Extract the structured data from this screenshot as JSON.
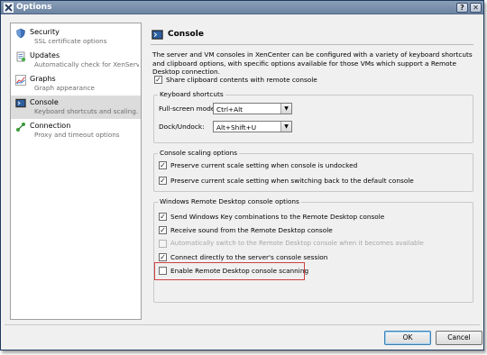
{
  "window": {
    "title": "Options"
  },
  "sidebar": {
    "items": [
      {
        "title": "Security",
        "desc": "SSL certificate options",
        "icon": "shield-icon",
        "selected": false
      },
      {
        "title": "Updates",
        "desc": "Automatically check for XenServ...",
        "icon": "updates-icon",
        "selected": false
      },
      {
        "title": "Graphs",
        "desc": "Graph appearance",
        "icon": "graph-icon",
        "selected": false
      },
      {
        "title": "Console",
        "desc": "Keyboard shortcuts and scaling...",
        "icon": "console-icon",
        "selected": true
      },
      {
        "title": "Connection",
        "desc": "Proxy and timeout options",
        "icon": "connection-icon",
        "selected": false
      }
    ]
  },
  "content": {
    "title": "Console",
    "description": "The server and VM consoles in XenCenter can be configured with a variety of keyboard shortcuts and clipboard options, with specific options available for those VMs which support a Remote Desktop connection.",
    "share_clipboard": {
      "label": "Share clipboard contents with remote console",
      "checked": true
    },
    "keyboard": {
      "group_label": "Keyboard shortcuts",
      "fullscreen_label": "Full-screen mode:",
      "fullscreen_value": "Ctrl+Alt",
      "dock_label": "Dock/Undock:",
      "dock_value": "Alt+Shift+U"
    },
    "scaling": {
      "group_label": "Console scaling options",
      "preserve_undocked": {
        "label": "Preserve current scale setting when console is undocked",
        "checked": true
      },
      "preserve_switching": {
        "label": "Preserve current scale setting when switching back to the default console",
        "checked": true
      }
    },
    "rdp": {
      "group_label": "Windows Remote Desktop console options",
      "send_windows_key": {
        "label": "Send Windows Key combinations to the Remote Desktop console",
        "checked": true
      },
      "receive_sound": {
        "label": "Receive sound from the Remote Desktop console",
        "checked": true
      },
      "auto_switch": {
        "label": "Automatically switch to the Remote Desktop console when it becomes available",
        "checked": false,
        "enabled": false
      },
      "connect_directly": {
        "label": "Connect directly to the server's console session",
        "checked": true
      },
      "enable_scanning": {
        "label": "Enable Remote Desktop console scanning",
        "checked": false
      }
    }
  },
  "buttons": {
    "ok": "OK",
    "cancel": "Cancel"
  },
  "colors": {
    "highlight": "#d04040",
    "titlebar": "#7890ad",
    "selected_row": "#dcdcdc"
  }
}
